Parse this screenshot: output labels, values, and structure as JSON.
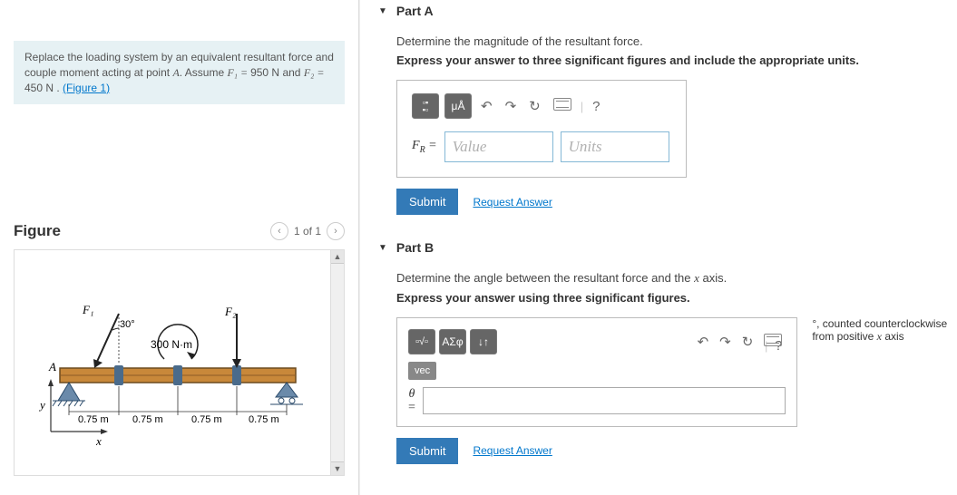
{
  "problem": {
    "text_prefix": "Replace the loading system by an equivalent resultant force and couple moment acting at point ",
    "pointA": "A",
    "assume": ". Assume ",
    "f1label": "F₁ = ",
    "f1val": "950 N",
    "and": " and ",
    "f2label": "F₂ = ",
    "f2val": "450 N",
    "period": " . ",
    "fig_link": "(Figure 1)"
  },
  "figure": {
    "heading": "Figure",
    "counter": "1 of 1",
    "labels": {
      "F1": "F₁",
      "F2": "F₂",
      "angle": "30°",
      "moment": "300 N·m",
      "A": "A",
      "y": "y",
      "x": "x",
      "d": "0.75 m"
    }
  },
  "partA": {
    "title": "Part A",
    "instr1": "Determine the magnitude of the resultant force.",
    "instr2": "Express your answer to three significant figures and include the appropriate units.",
    "toolbar": {
      "units_btn": "μÅ",
      "help": "?"
    },
    "prefix_var": "F",
    "prefix_sub": "R",
    "equals": " = ",
    "value_ph": "Value",
    "units_ph": "Units",
    "submit": "Submit",
    "request": "Request Answer"
  },
  "partB": {
    "title": "Part B",
    "instr1": "Determine the angle between the resultant force and the x axis.",
    "instr2": "Express your answer using three significant figures.",
    "toolbar": {
      "sigma": "ΑΣφ",
      "arrows": "↓↑",
      "help": "?"
    },
    "vec": "vec",
    "theta": "θ",
    "equals": "=",
    "suffix_deg": "°",
    "suffix_text": ", counted counterclockwise from positive ",
    "suffix_axis": "x",
    "suffix_text2": " axis",
    "submit": "Submit",
    "request": "Request Answer"
  }
}
